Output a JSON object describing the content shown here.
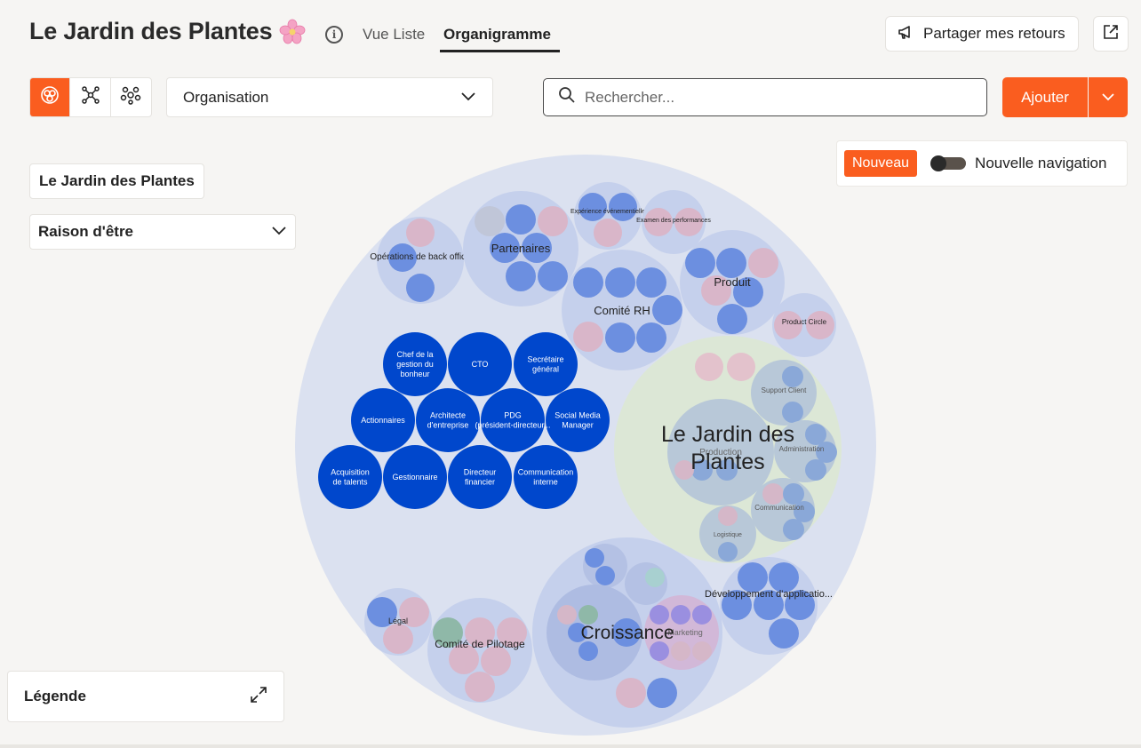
{
  "header": {
    "title": "Le Jardin des Plantes",
    "tabs": [
      "Vue Liste",
      "Organigramme"
    ],
    "share_label": "Partager mes retours"
  },
  "toolbar": {
    "select_value": "Organisation",
    "search_placeholder": "Rechercher...",
    "add_label": "Ajouter"
  },
  "nav": {
    "badge": "Nouveau",
    "label": "Nouvelle navigation"
  },
  "sidebar": {
    "breadcrumb": "Le Jardin des Plantes",
    "purpose_label": "Raison d'être"
  },
  "legend": {
    "label": "Légende"
  },
  "colors": {
    "accent": "#fa5d1f",
    "role_dark": "#0047cc",
    "role_blue": "#6c8fe0",
    "role_pink": "#d9b6c9",
    "circle_bg": "#dbe1f0",
    "circle_mid": "#c5d0ec",
    "green_bg": "#dce7d6"
  },
  "org": {
    "root_label": "Le Jardin des Plantes",
    "circles": {
      "ops": "Opérations de back office",
      "partners": "Partenaires",
      "events": "Expérience événementielle",
      "reviews": "Examen des performances",
      "hr": "Comité RH",
      "product": "Produit",
      "product_circle": "Product Circle",
      "support": "Support Client",
      "production": "Production",
      "admin": "Administration",
      "comms": "Communication",
      "logistics": "Logistique",
      "legal": "Légal",
      "steering": "Comité de Pilotage",
      "growth": "Croissance",
      "marketing": "Marketing",
      "dev": "Développement d'applicatio..."
    },
    "roles": [
      "Chef de la gestion du bonheur",
      "CTO",
      "Secrétaire général",
      "Actionnaires",
      "Architecte d'entreprise",
      "PDG (président-directeur...",
      "Social Media Manager",
      "Acquisition de talents",
      "Gestionnaire",
      "Directeur financier",
      "Communication interne"
    ]
  }
}
